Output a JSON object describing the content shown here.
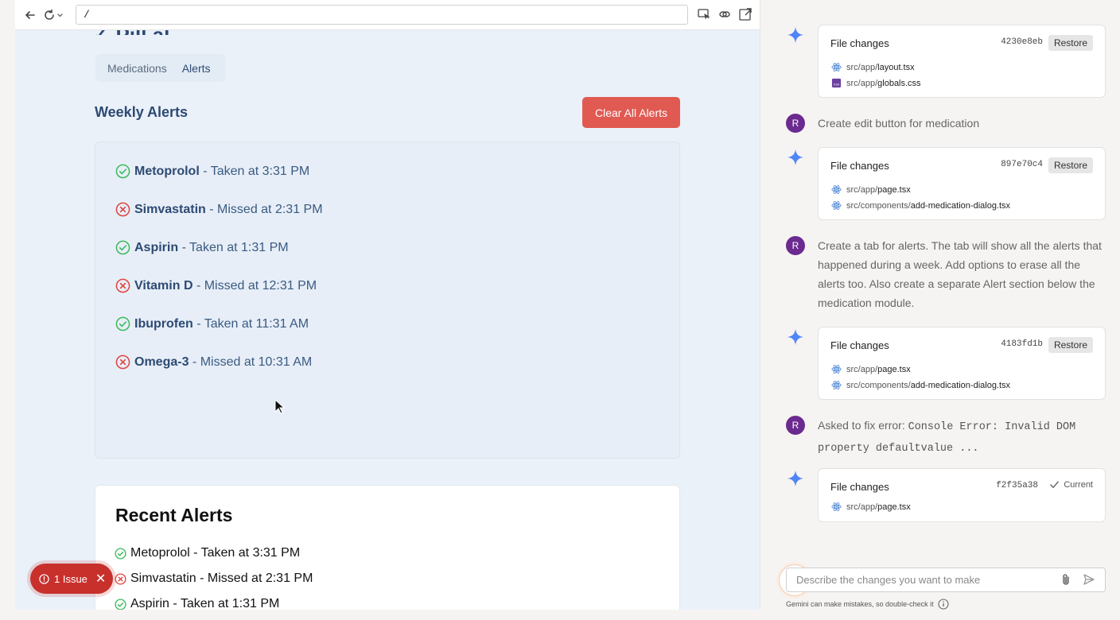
{
  "browser": {
    "url": "/"
  },
  "app": {
    "title_fragment": "Pill  al",
    "tabs": [
      {
        "label": "Medications",
        "active": false
      },
      {
        "label": "Alerts",
        "active": true
      }
    ],
    "weekly": {
      "title": "Weekly Alerts",
      "clear_button": "Clear All Alerts",
      "alerts": [
        {
          "name": "Metoprolol",
          "detail": " - Taken at 3:31 PM",
          "status": "taken"
        },
        {
          "name": "Simvastatin",
          "detail": " - Missed at 2:31 PM",
          "status": "missed"
        },
        {
          "name": "Aspirin",
          "detail": " - Taken at 1:31 PM",
          "status": "taken"
        },
        {
          "name": "Vitamin D",
          "detail": " - Missed at 12:31 PM",
          "status": "missed"
        },
        {
          "name": "Ibuprofen",
          "detail": " - Taken at 11:31 AM",
          "status": "taken"
        },
        {
          "name": "Omega-3",
          "detail": " - Missed at 10:31 AM",
          "status": "missed"
        }
      ]
    },
    "recent": {
      "title": "Recent Alerts",
      "alerts": [
        {
          "text": "Metoprolol - Taken at 3:31 PM",
          "status": "taken"
        },
        {
          "text": "Simvastatin - Missed at 2:31 PM",
          "status": "missed"
        },
        {
          "text": "Aspirin - Taken at 1:31 PM",
          "status": "taken"
        }
      ]
    },
    "issue_badge": "1 Issue"
  },
  "colors": {
    "taken": "#3dba5c",
    "missed": "#e0453f",
    "primary_text": "#2d4a73",
    "clear_button": "#e05a52",
    "avatar": "#6b2a8f",
    "spark": "#4f86f7"
  },
  "chat": {
    "entries": [
      {
        "type": "changes",
        "heading": "File changes",
        "hash": "4230e8eb",
        "action": "Restore",
        "files": [
          {
            "dir": "src/app/",
            "name": "layout.tsx",
            "icon": "react-icon"
          },
          {
            "dir": "src/app/",
            "name": "globals.css",
            "icon": "css-icon"
          }
        ]
      },
      {
        "type": "user",
        "avatar": "R",
        "text": "Create edit button for medication"
      },
      {
        "type": "changes",
        "heading": "File changes",
        "hash": "897e70c4",
        "action": "Restore",
        "files": [
          {
            "dir": "src/app/",
            "name": "page.tsx",
            "icon": "react-icon"
          },
          {
            "dir": "src/components/",
            "name": "add-medication-dialog.tsx",
            "icon": "react-icon"
          }
        ]
      },
      {
        "type": "user",
        "avatar": "R",
        "text": "Create a tab for alerts. The tab will show all the alerts that happened during a week. Add options to erase all the alerts too. Also create a separate Alert section below the medication module."
      },
      {
        "type": "changes",
        "heading": "File changes",
        "hash": "4183fd1b",
        "action": "Restore",
        "files": [
          {
            "dir": "src/app/",
            "name": "page.tsx",
            "icon": "react-icon"
          },
          {
            "dir": "src/components/",
            "name": "add-medication-dialog.tsx",
            "icon": "react-icon"
          }
        ]
      },
      {
        "type": "user",
        "avatar": "R",
        "text_prefix": "Asked to fix error: ",
        "text_code": "Console Error: Invalid DOM property",
        "text_suffix": " defaultvalue ..."
      },
      {
        "type": "changes",
        "heading": "File changes",
        "hash": "f2f35a38",
        "action": "Current",
        "files": [
          {
            "dir": "src/app/",
            "name": "page.tsx",
            "icon": "react-icon"
          }
        ]
      }
    ],
    "input_placeholder": "Describe the changes you want to make",
    "disclaimer": "Gemini can make mistakes, so double-check it"
  }
}
